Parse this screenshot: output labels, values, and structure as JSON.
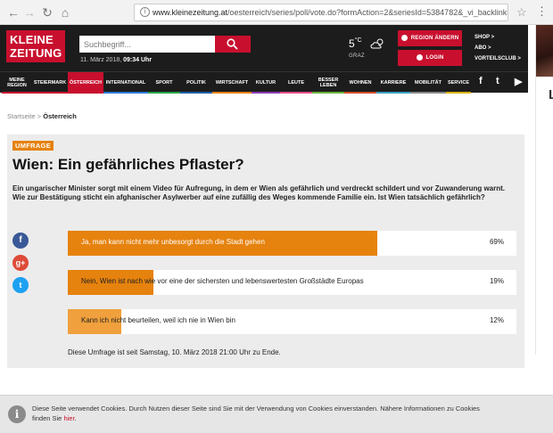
{
  "browser": {
    "url_host": "www.kleinezeitung.at",
    "url_path": "/oesterreich/series/poll/vote.do?formAction=2&seriesId=5384782&_vi_backlink=..."
  },
  "header": {
    "logo_line1": "KLEINE",
    "logo_line2": "ZEITUNG",
    "search_placeholder": "Suchbegriff...",
    "date": "11. März 2018,",
    "time": "09:34 Uhr",
    "weather_temp": "5",
    "weather_unit": "°C",
    "weather_city": "GRAZ",
    "region_button": "REGION ÄNDERN",
    "login_button": "LOGIN",
    "side_links": [
      "SHOP >",
      "ABO >",
      "VORTEILSCLUB >"
    ]
  },
  "nav": {
    "items": [
      "MEINE REGION",
      "STEIERMARK",
      "ÖSTERREICH",
      "INTERNATIONAL",
      "SPORT",
      "POLITIK",
      "WIRTSCHAFT",
      "KULTUR",
      "LEUTE",
      "BESSER LEBEN",
      "WOHNEN",
      "KARRIERE",
      "MOBILITÄT",
      "SERVICE"
    ],
    "social": [
      "f",
      "t",
      "▶"
    ]
  },
  "breadcrumb": {
    "home": "Startseite",
    "sep": ">",
    "current": "Österreich"
  },
  "poll": {
    "tag": "UMFRAGE",
    "title": "Wien: Ein gefährliches Pflaster?",
    "description": "Ein ungarischer Minister sorgt mit einem Video für Aufregung, in dem er Wien als gefährlich und verdreckt schildert und vor Zuwanderung warnt. Wie zur Bestätigung sticht ein afghanischer Asylwerber auf eine zufällig des Weges kommende Familie ein. Ist Wien tatsächlich gefährlich?",
    "answers": [
      {
        "text": "Ja, man kann nicht mehr unbesorgt durch die Stadt gehen",
        "percent": "69%",
        "share": 0.69
      },
      {
        "text": "Nein, Wien ist nach wie vor eine der sichersten und lebenswertesten Großstädte Europas",
        "percent": "19%",
        "share": 0.19
      },
      {
        "text": "Kann ich nicht beurteilen, weil ich nie in Wien bin",
        "percent": "12%",
        "share": 0.12
      }
    ],
    "footer": "Diese Umfrage ist seit Samstag, 10. März 2018 21:00 Uhr zu Ende."
  },
  "ad": {
    "letter": "L"
  },
  "cookie": {
    "text": "Diese Seite verwendet Cookies. Durch Nutzen dieser Seite sind Sie mit der Verwendung von Cookies einverstanden. Nähere Informationen zu Cookies finden Sie",
    "link": "hier",
    "end": "."
  },
  "colors": {
    "brand_red": "#c8102e",
    "poll_orange": "#e6820e",
    "nav_bar_colors": [
      "#c8102e",
      "#c8102e",
      "#c8102e",
      "#2b7bd6",
      "#29a34a",
      "#1f5fa8",
      "#e6820e",
      "#8a3db5",
      "#e94b8a",
      "#6bb33b",
      "#d24d2a",
      "#3a9fc2",
      "#888888",
      "#d9b400"
    ]
  }
}
